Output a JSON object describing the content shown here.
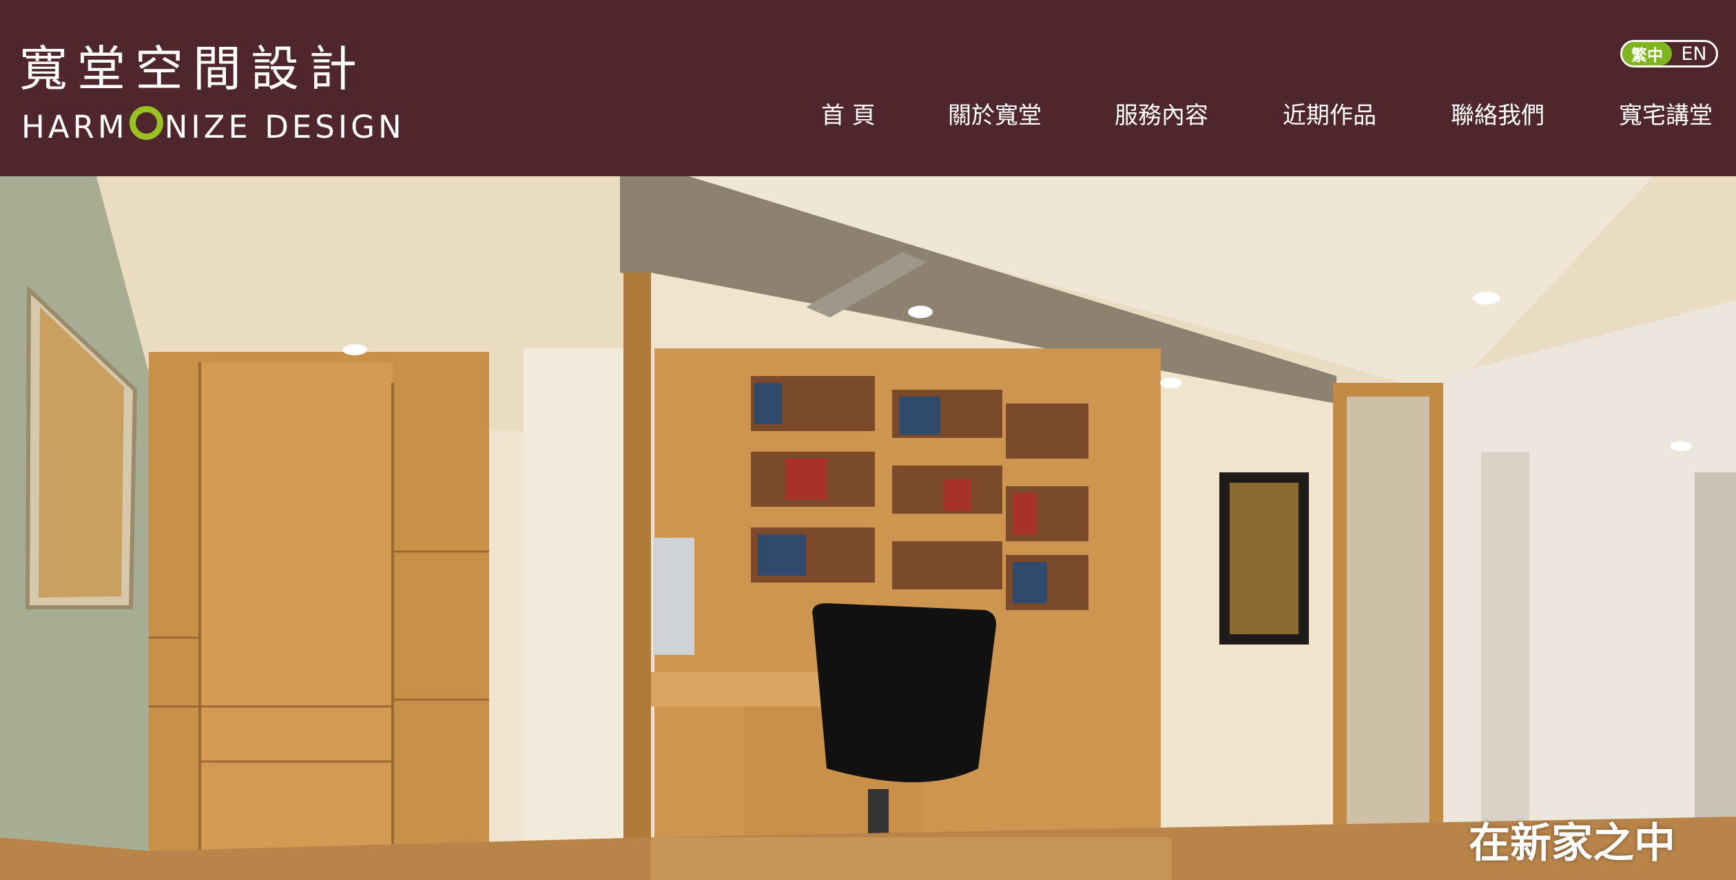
{
  "brand": {
    "name_cn": "寬堂空間設計",
    "name_en_prefix": "HARM",
    "name_en_suffix": "NIZE DESIGN",
    "accent_color": "#97c21f",
    "background_color": "#4f262b"
  },
  "language": {
    "active": "繁中",
    "other": "EN"
  },
  "nav": {
    "items": [
      {
        "label": "首 頁"
      },
      {
        "label": "關於寬堂"
      },
      {
        "label": "服務內容"
      },
      {
        "label": "近期作品"
      },
      {
        "label": "聯絡我們"
      },
      {
        "label": "寬宅講堂"
      }
    ]
  },
  "hero": {
    "caption_line1": "在新家之中",
    "caption_line2": "",
    "image_subject": "study room interior with bookshelves, desk and black office chair"
  }
}
